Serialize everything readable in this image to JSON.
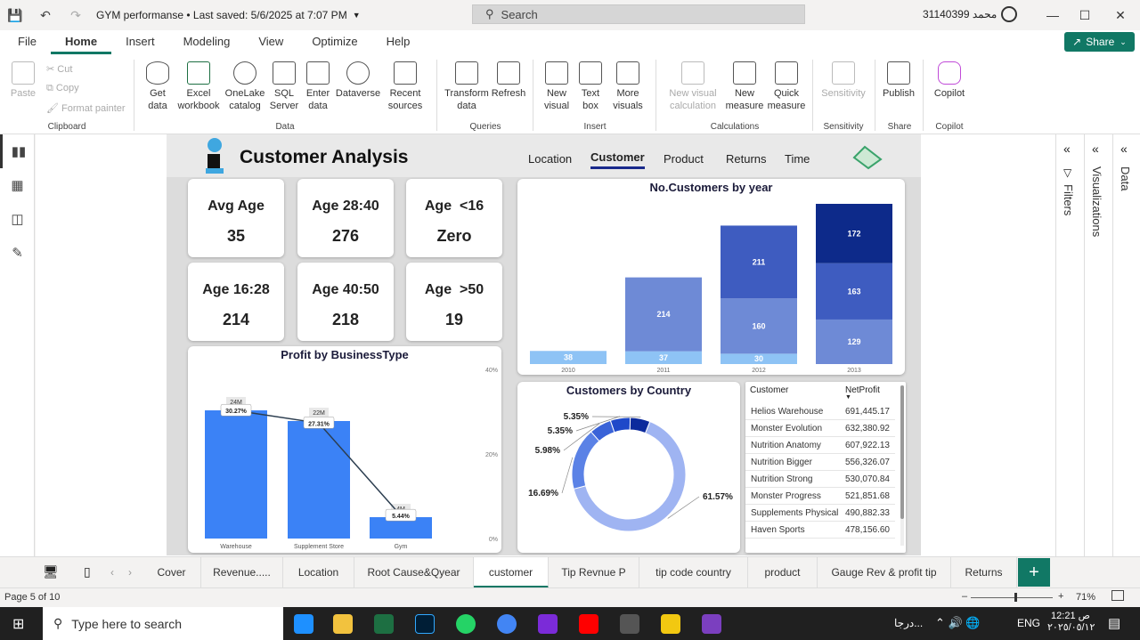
{
  "titlebar": {
    "title": "GYM performanse • Last saved: 5/6/2025 at 7:07 PM",
    "search": "Search",
    "user": "31140399 محمد"
  },
  "menu": [
    "File",
    "Home",
    "Insert",
    "Modeling",
    "View",
    "Optimize",
    "Help"
  ],
  "share": "Share",
  "ribbon": {
    "clipboard": {
      "paste": "Paste",
      "cut": "Cut",
      "copy": "Copy",
      "format_painter": "Format painter",
      "group": "Clipboard"
    },
    "data": {
      "get_data": [
        "Get",
        "data"
      ],
      "excel": [
        "Excel",
        "workbook"
      ],
      "onelake": [
        "OneLake",
        "catalog"
      ],
      "sql": [
        "SQL",
        "Server"
      ],
      "enter": [
        "Enter",
        "data"
      ],
      "dataverse": "Dataverse",
      "recent": [
        "Recent",
        "sources"
      ],
      "group": "Data"
    },
    "queries": {
      "transform": [
        "Transform",
        "data"
      ],
      "refresh": "Refresh",
      "group": "Queries"
    },
    "insert": {
      "new_visual": [
        "New",
        "visual"
      ],
      "text_box": [
        "Text",
        "box"
      ],
      "more": [
        "More",
        "visuals"
      ],
      "group": "Insert"
    },
    "calc": {
      "new_visual_calc": [
        "New visual",
        "calculation"
      ],
      "new_measure": [
        "New",
        "measure"
      ],
      "quick_measure": [
        "Quick",
        "measure"
      ],
      "group": "Calculations"
    },
    "sensitivity": {
      "label": "Sensitivity",
      "group": "Sensitivity"
    },
    "share": {
      "publish": "Publish",
      "group": "Share"
    },
    "copilot": {
      "label": "Copilot",
      "group": "Copilot"
    }
  },
  "report": {
    "title": "Customer Analysis",
    "nav": [
      "Location",
      "Customer",
      "Product",
      "Returns",
      "Time"
    ],
    "kpis": [
      {
        "label": "Avg Age",
        "value": "35"
      },
      {
        "label": "Age 28:40",
        "value": "276"
      },
      {
        "label": "Age  <16",
        "value": "Zero"
      },
      {
        "label": "Age 16:28",
        "value": "214"
      },
      {
        "label": "Age 40:50",
        "value": "218"
      },
      {
        "label": "Age  >50",
        "value": "19"
      }
    ],
    "table": {
      "headers": [
        "Customer",
        "NetProfit"
      ],
      "rows": [
        [
          "Helios Warehouse",
          "691,445.17"
        ],
        [
          "Monster Evolution",
          "632,380.92"
        ],
        [
          "Nutrition Anatomy",
          "607,922.13"
        ],
        [
          "Nutrition Bigger",
          "556,326.07"
        ],
        [
          "Nutrition Strong",
          "530,070.84"
        ],
        [
          "Monster Progress",
          "521,851.68"
        ],
        [
          "Supplements Physical",
          "490,882.33"
        ],
        [
          "Haven Sports",
          "478,156.60"
        ]
      ]
    }
  },
  "chart_data": [
    {
      "type": "bar",
      "title": "No.Customers by year",
      "stacked": true,
      "categories": [
        "2010",
        "2011",
        "2012",
        "2013"
      ],
      "series": [
        {
          "values": [
            38,
            37,
            30,
            null
          ],
          "color": "#8ec3f5"
        },
        {
          "values": [
            null,
            214,
            160,
            129
          ],
          "color": "#6e8ad6"
        },
        {
          "values": [
            null,
            null,
            211,
            163
          ],
          "color": "#3e5cc0"
        },
        {
          "values": [
            null,
            null,
            null,
            172
          ],
          "color": "#0d2a8a"
        }
      ]
    },
    {
      "type": "bar",
      "title": "Profit by BusinessType",
      "categories": [
        "Warehouse",
        "Supplement Store",
        "Gym"
      ],
      "values": [
        24,
        22,
        4
      ],
      "value_labels": [
        "24M",
        "22M",
        "4M"
      ],
      "line_values": [
        30.27,
        27.31,
        5.44
      ],
      "line_labels": [
        "30.27%",
        "27.31%",
        "5.44%"
      ],
      "y2_ticks": [
        "40%",
        "20%",
        "0%"
      ],
      "ylim": [
        0,
        30
      ],
      "y2lim": [
        0,
        40
      ],
      "bar_color": "#3b82f6"
    },
    {
      "type": "pie",
      "title": "Customers by Country",
      "donut": true,
      "values": [
        61.57,
        16.69,
        5.98,
        5.35,
        5.35
      ],
      "labels": [
        "61.57%",
        "16.69%",
        "5.98%",
        "5.35%",
        "5.35%"
      ],
      "colors": [
        "#9fb4f2",
        "#5b82e6",
        "#3a63d8",
        "#1f49c9",
        "#0c2a9c"
      ]
    }
  ],
  "tabs": [
    "Cover",
    "Revenue.....",
    "Location",
    "Root Cause&Qyear",
    "customer",
    "Tip Revnue P",
    "tip code country",
    "product",
    "Gauge Rev & profit tip",
    "Returns"
  ],
  "status": {
    "page": "Page 5 of 10",
    "zoom": "71%",
    "zoom_level": 0.71
  },
  "taskbar": {
    "search": "Type here to search",
    "lang": "ENG",
    "time": "12:21 ص",
    "date": "٢٠٢٥/٠٥/١٢",
    "weather": "درجا..."
  },
  "panes": {
    "filters": "Filters",
    "visualizations": "Visualizations",
    "data": "Data"
  }
}
